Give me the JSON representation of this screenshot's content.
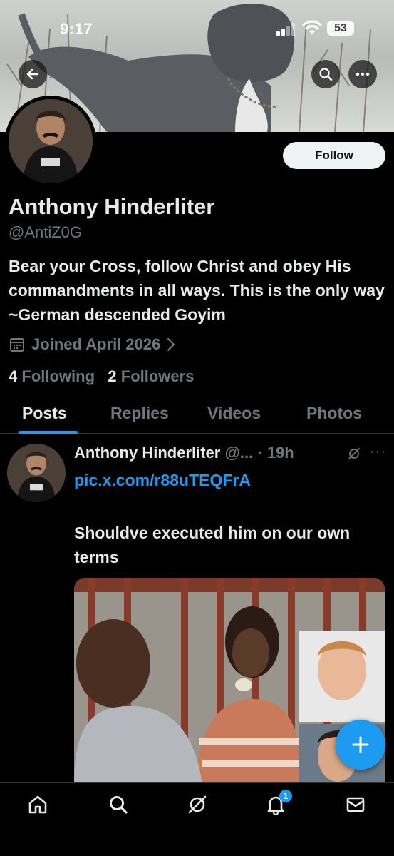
{
  "status_bar": {
    "time": "9:17",
    "battery": "53"
  },
  "profile": {
    "name": "Anthony Hinderliter",
    "handle": "@AntiZ0G",
    "bio": "Bear your Cross, follow Christ and obey His commandments in all ways. This is the only way ~German descended Goyim",
    "joined": "Joined April 2026",
    "following_count": "4",
    "following_label": "Following",
    "followers_count": "2",
    "followers_label": "Followers",
    "follow_button": "Follow"
  },
  "tabs": [
    {
      "label": "Posts",
      "active": true
    },
    {
      "label": "Replies",
      "active": false
    },
    {
      "label": "Videos",
      "active": false
    },
    {
      "label": "Photos",
      "active": false
    }
  ],
  "post": {
    "author": "Anthony Hinderliter",
    "handle_truncated": "@...",
    "separator": " · ",
    "time": "19h",
    "link": "pic.x.com/r88uTEQFrA",
    "text": "Shouldve executed him on our own terms"
  },
  "notifications_badge": "1",
  "icons": {
    "back": "arrow-left-icon",
    "search": "search-icon",
    "more": "more-horizontal-icon",
    "calendar": "calendar-icon",
    "home": "home-icon",
    "grok": "grok-icon",
    "bell": "bell-icon",
    "mail": "mail-icon",
    "compose": "plus-icon"
  },
  "colors": {
    "accent": "#1d9bf0",
    "background": "#000000",
    "text": "#e7e9ea",
    "muted": "#71767b"
  }
}
